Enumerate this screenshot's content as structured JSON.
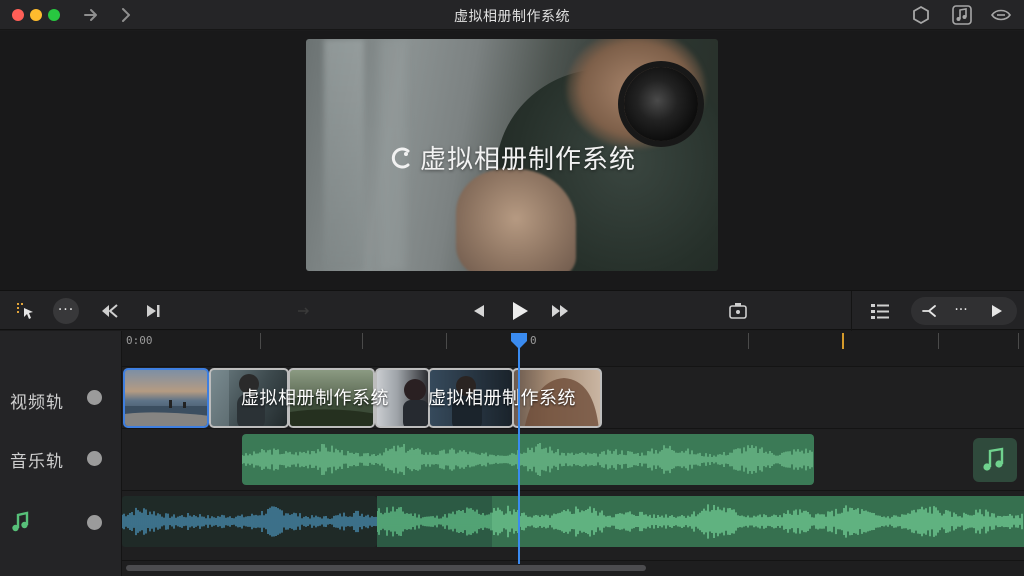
{
  "window": {
    "title": "虚拟相册制作系统"
  },
  "preview": {
    "overlay_title": "虚拟相册制作系统"
  },
  "toolbar": {
    "more_label": "···",
    "pill_more_label": "···"
  },
  "ruler": {
    "start_label": "0:00",
    "mid_label": "0"
  },
  "tracks": [
    {
      "label": "视频轨"
    },
    {
      "label": "音乐轨"
    },
    {
      "label": ""
    }
  ],
  "clips": {
    "video": [
      {
        "kind": "beach"
      },
      {
        "kind": "title",
        "text": "虚拟相册制作系统"
      },
      {
        "kind": "landscape"
      },
      {
        "kind": "title",
        "text": "虚拟相册制作系统"
      },
      {
        "kind": "portrait"
      }
    ]
  },
  "colors": {
    "playhead": "#3a8bf0",
    "audio_clip": "#3b7a56",
    "selection": "#3f7fe0",
    "marker": "#d49a2b"
  },
  "icons": {
    "nav_back": "chevron-right-arrow-icon",
    "nav_forward": "chevron-right-icon",
    "settings": "hexagon-icon",
    "music_library": "music-note-icon",
    "view_toggle": "eye-icon",
    "playback": [
      "previous-icon",
      "play-icon",
      "fast-forward-icon"
    ]
  }
}
